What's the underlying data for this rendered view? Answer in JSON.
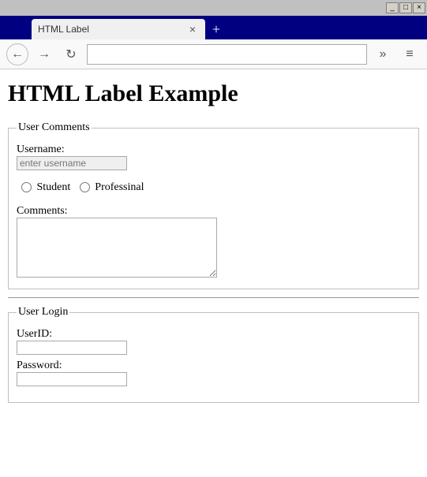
{
  "window": {
    "minimize": "_",
    "maximize": "□",
    "close": "×"
  },
  "tab": {
    "title": "HTML Label",
    "close": "×",
    "add": "+"
  },
  "toolbar": {
    "back": "←",
    "forward": "→",
    "reload": "↻",
    "overflow": "»",
    "menu": "≡",
    "url": ""
  },
  "page": {
    "heading": "HTML Label Example"
  },
  "comments_form": {
    "legend": "User Comments",
    "username_label": "Username:",
    "username_placeholder": "enter username",
    "radio_student": "Student",
    "radio_professional": "Professinal",
    "comments_label": "Comments:"
  },
  "login_form": {
    "legend": "User Login",
    "userid_label": "UserID:",
    "password_label": "Password:"
  }
}
